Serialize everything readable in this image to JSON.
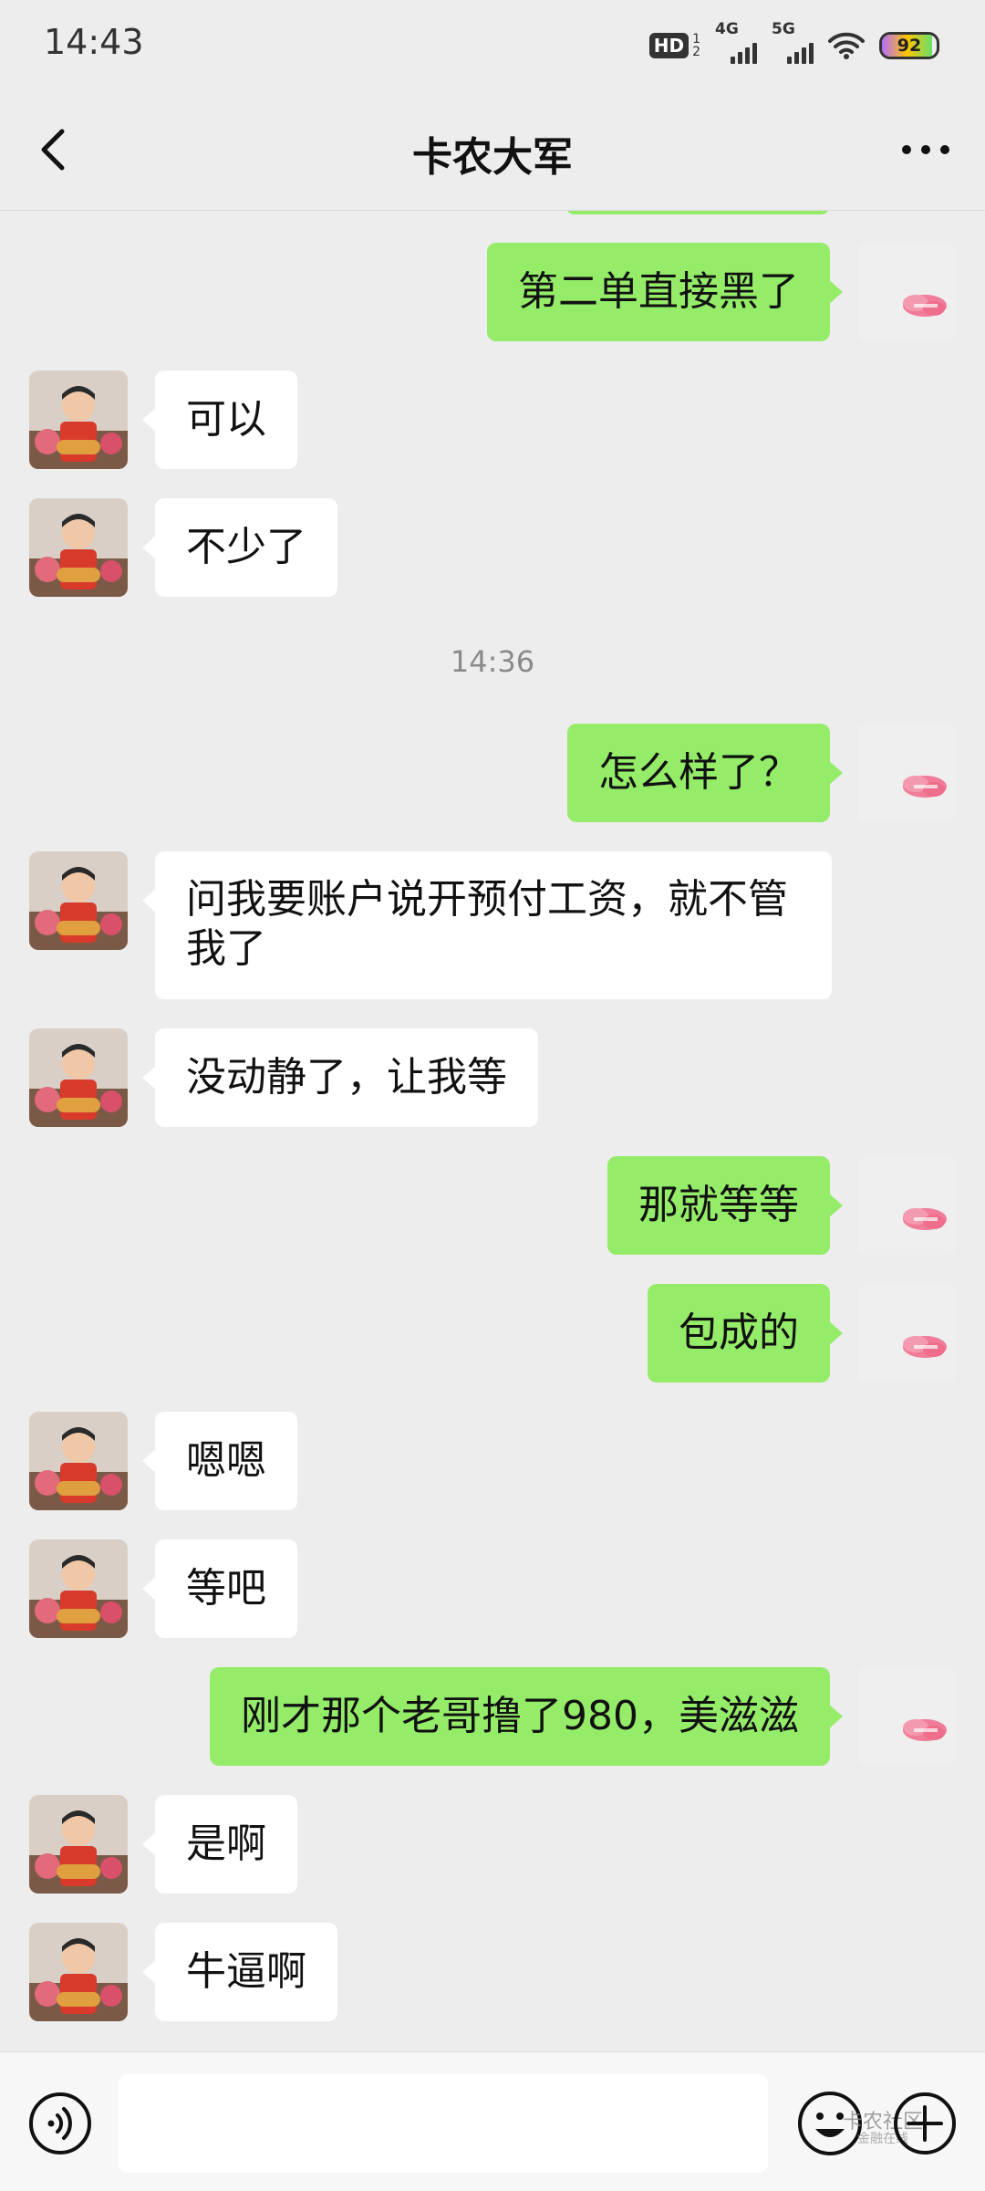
{
  "status_bar": {
    "time": "14:43",
    "hd_label": "HD",
    "hd_sub1": "1",
    "hd_sub2": "2",
    "net1": "4G",
    "net2": "5G",
    "battery": "92",
    "battery_level": 0.92
  },
  "header": {
    "title": "卡农大军"
  },
  "messages": [
    {
      "side": "out",
      "text": "第二单直接黑了"
    },
    {
      "side": "in",
      "text": "可以"
    },
    {
      "side": "in",
      "text": "不少了"
    },
    {
      "type": "time",
      "text": "14:36"
    },
    {
      "side": "out",
      "text": "怎么样了？"
    },
    {
      "side": "in",
      "text": "问我要账户说开预付工资，就不管我了"
    },
    {
      "side": "in",
      "text": "没动静了，让我等"
    },
    {
      "side": "out",
      "text": "那就等等"
    },
    {
      "side": "out",
      "text": "包成的"
    },
    {
      "side": "in",
      "text": "嗯嗯"
    },
    {
      "side": "in",
      "text": "等吧"
    },
    {
      "side": "out",
      "text": "刚才那个老哥撸了980，美滋滋"
    },
    {
      "side": "in",
      "text": "是啊"
    },
    {
      "side": "in",
      "text": "牛逼啊"
    }
  ],
  "input": {
    "value": "",
    "placeholder": ""
  },
  "watermark": {
    "text": "卡农社区",
    "sub": "金融在线"
  },
  "colors": {
    "background": "#ededed",
    "outgoing_bubble": "#95ec69",
    "incoming_bubble": "#ffffff"
  }
}
